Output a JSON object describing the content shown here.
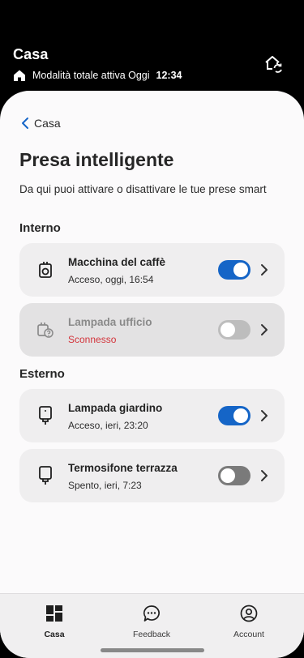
{
  "header": {
    "title": "Casa",
    "status_text": "Modalità totale attiva Oggi",
    "status_time": "12:34"
  },
  "nav_back": {
    "label": "Casa"
  },
  "page": {
    "title": "Presa intelligente",
    "subtitle": "Da qui puoi attivare o disattivare le tue prese smart"
  },
  "sections": [
    {
      "title": "Interno",
      "devices": [
        {
          "name": "Macchina del caffè",
          "status": "Acceso, oggi, 16:54",
          "state": "on",
          "icon": "coffee-plug-icon"
        },
        {
          "name": "Lampada ufficio",
          "status": "Sconnesso",
          "state": "disconnected",
          "icon": "plug-disconnected-icon"
        }
      ]
    },
    {
      "title": "Esterno",
      "devices": [
        {
          "name": "Lampada giardino",
          "status": "Acceso, ieri, 23:20",
          "state": "on",
          "icon": "plug-icon"
        },
        {
          "name": "Termosifone terrazza",
          "status": "Spento, ieri, 7:23",
          "state": "off",
          "icon": "plug-icon"
        }
      ]
    }
  ],
  "bottom_nav": [
    {
      "label": "Casa",
      "icon": "grid-home-icon",
      "active": true
    },
    {
      "label": "Feedback",
      "icon": "chat-bubble-icon",
      "active": false
    },
    {
      "label": "Account",
      "icon": "account-circle-icon",
      "active": false
    }
  ],
  "colors": {
    "accent": "#1565c7",
    "error": "#d3343b",
    "header_bg": "#000000",
    "sheet_bg": "#fbfafb"
  }
}
